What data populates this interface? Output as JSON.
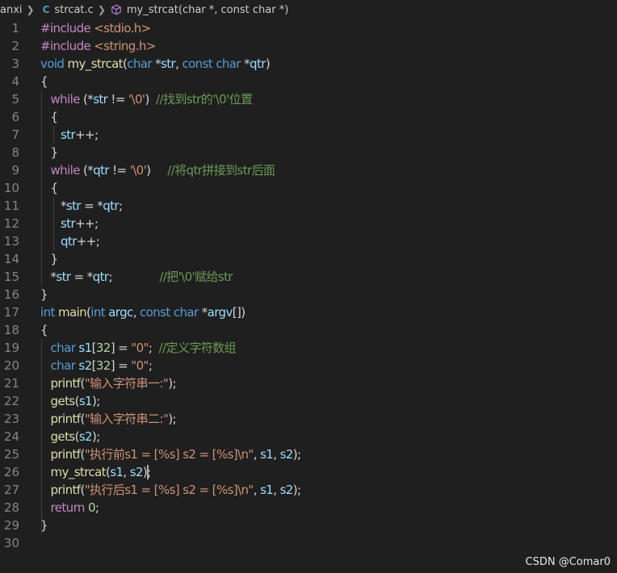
{
  "breadcrumb": {
    "folder": "anxi",
    "file": "strcat.c",
    "file_icon": "C",
    "symbol": "my_strcat(char *, const char *)"
  },
  "watermark": "CSDN @Comar0",
  "code_lines": [
    [
      [
        "pp",
        "#include "
      ],
      [
        "inc",
        "<stdio.h>"
      ]
    ],
    [
      [
        "pp",
        "#include "
      ],
      [
        "inc",
        "<string.h>"
      ]
    ],
    [
      [
        "kw",
        "void "
      ],
      [
        "fn",
        "my_strcat"
      ],
      [
        "pl",
        "("
      ],
      [
        "kw",
        "char "
      ],
      [
        "pl",
        "*"
      ],
      [
        "var",
        "str"
      ],
      [
        "pl",
        ", "
      ],
      [
        "kw",
        "const char "
      ],
      [
        "pl",
        "*"
      ],
      [
        "var",
        "qtr"
      ],
      [
        "pl",
        ")"
      ]
    ],
    [
      [
        "br",
        "{"
      ]
    ],
    [
      [
        "pl",
        "   "
      ],
      [
        "ctl",
        "while "
      ],
      [
        "pl",
        "(*"
      ],
      [
        "var",
        "str"
      ],
      [
        "pl",
        " != "
      ],
      [
        "str",
        "'\\0'"
      ],
      [
        "pl",
        ")  "
      ],
      [
        "cmt",
        "//找到str的'\\0'位置"
      ]
    ],
    [
      [
        "pl",
        "   "
      ],
      [
        "br",
        "{"
      ]
    ],
    [
      [
        "pl",
        "      "
      ],
      [
        "var",
        "str"
      ],
      [
        "pl",
        "++;"
      ]
    ],
    [
      [
        "pl",
        "   "
      ],
      [
        "br",
        "}"
      ]
    ],
    [
      [
        "pl",
        "   "
      ],
      [
        "ctl",
        "while "
      ],
      [
        "pl",
        "(*"
      ],
      [
        "var",
        "qtr"
      ],
      [
        "pl",
        " != "
      ],
      [
        "str",
        "'\\0'"
      ],
      [
        "pl",
        ")     "
      ],
      [
        "cmt",
        "//将qtr拼接到str后面"
      ]
    ],
    [
      [
        "pl",
        "   "
      ],
      [
        "br",
        "{"
      ]
    ],
    [
      [
        "pl",
        "      "
      ],
      [
        "pl",
        "*"
      ],
      [
        "var",
        "str"
      ],
      [
        "pl",
        " = *"
      ],
      [
        "var",
        "qtr"
      ],
      [
        "pl",
        ";"
      ]
    ],
    [
      [
        "pl",
        "      "
      ],
      [
        "var",
        "str"
      ],
      [
        "pl",
        "++;"
      ]
    ],
    [
      [
        "pl",
        "      "
      ],
      [
        "var",
        "qtr"
      ],
      [
        "pl",
        "++;"
      ]
    ],
    [
      [
        "pl",
        "   "
      ],
      [
        "br",
        "}"
      ]
    ],
    [
      [
        "pl",
        "   "
      ],
      [
        "pl",
        "*"
      ],
      [
        "var",
        "str"
      ],
      [
        "pl",
        " = *"
      ],
      [
        "var",
        "qtr"
      ],
      [
        "pl",
        ";              "
      ],
      [
        "cmt",
        "//把'\\0'赋给str"
      ]
    ],
    [
      [
        "br",
        "}"
      ]
    ],
    [
      [
        "kw",
        "int "
      ],
      [
        "fn",
        "main"
      ],
      [
        "pl",
        "("
      ],
      [
        "kw",
        "int "
      ],
      [
        "var",
        "argc"
      ],
      [
        "pl",
        ", "
      ],
      [
        "kw",
        "const char "
      ],
      [
        "pl",
        "*"
      ],
      [
        "var",
        "argv"
      ],
      [
        "pl",
        "[]"
      ],
      [
        "pl",
        ")"
      ]
    ],
    [
      [
        "br",
        "{"
      ]
    ],
    [
      [
        "pl",
        "   "
      ],
      [
        "kw",
        "char "
      ],
      [
        "var",
        "s1"
      ],
      [
        "pl",
        "["
      ],
      [
        "num",
        "32"
      ],
      [
        "pl",
        "] = "
      ],
      [
        "str",
        "\"0\""
      ],
      [
        "pl",
        ";  "
      ],
      [
        "cmt",
        "//定义字符数组"
      ]
    ],
    [
      [
        "pl",
        "   "
      ],
      [
        "kw",
        "char "
      ],
      [
        "var",
        "s2"
      ],
      [
        "pl",
        "["
      ],
      [
        "num",
        "32"
      ],
      [
        "pl",
        "] = "
      ],
      [
        "str",
        "\"0\""
      ],
      [
        "pl",
        ";"
      ]
    ],
    [
      [
        "pl",
        "   "
      ],
      [
        "fn",
        "printf"
      ],
      [
        "pl",
        "("
      ],
      [
        "str",
        "\"输入字符串一:\""
      ],
      [
        "pl",
        ");"
      ]
    ],
    [
      [
        "pl",
        "   "
      ],
      [
        "fn",
        "gets"
      ],
      [
        "pl",
        "("
      ],
      [
        "var",
        "s1"
      ],
      [
        "pl",
        ");"
      ]
    ],
    [
      [
        "pl",
        "   "
      ],
      [
        "fn",
        "printf"
      ],
      [
        "pl",
        "("
      ],
      [
        "str",
        "\"输入字符串二:\""
      ],
      [
        "pl",
        ");"
      ]
    ],
    [
      [
        "pl",
        "   "
      ],
      [
        "fn",
        "gets"
      ],
      [
        "pl",
        "("
      ],
      [
        "var",
        "s2"
      ],
      [
        "pl",
        ");"
      ]
    ],
    [
      [
        "pl",
        "   "
      ],
      [
        "fn",
        "printf"
      ],
      [
        "pl",
        "("
      ],
      [
        "str",
        "\"执行前s1 = [%s] s2 = [%s]\\n\""
      ],
      [
        "pl",
        ", "
      ],
      [
        "var",
        "s1"
      ],
      [
        "pl",
        ", "
      ],
      [
        "var",
        "s2"
      ],
      [
        "pl",
        ");"
      ]
    ],
    [
      [
        "pl",
        "   "
      ],
      [
        "fn",
        "my_strcat"
      ],
      [
        "pl",
        "("
      ],
      [
        "var",
        "s1"
      ],
      [
        "pl",
        ", "
      ],
      [
        "var",
        "s2"
      ],
      [
        "pl",
        ");"
      ]
    ],
    [
      [
        "pl",
        "   "
      ],
      [
        "fn",
        "printf"
      ],
      [
        "pl",
        "("
      ],
      [
        "str",
        "\"执行后s1 = [%s] s2 = [%s]\\n\""
      ],
      [
        "pl",
        ", "
      ],
      [
        "var",
        "s1"
      ],
      [
        "pl",
        ", "
      ],
      [
        "var",
        "s2"
      ],
      [
        "pl",
        ");"
      ]
    ],
    [
      [
        "pl",
        "   "
      ],
      [
        "ctl",
        "return "
      ],
      [
        "num",
        "0"
      ],
      [
        "pl",
        ";"
      ]
    ],
    [
      [
        "br",
        "}"
      ]
    ],
    [
      [
        "pl",
        ""
      ]
    ]
  ],
  "line_numbers": [
    "1",
    "2",
    "3",
    "4",
    "5",
    "6",
    "7",
    "8",
    "9",
    "10",
    "11",
    "12",
    "13",
    "14",
    "15",
    "16",
    "17",
    "18",
    "19",
    "20",
    "21",
    "22",
    "23",
    "24",
    "25",
    "26",
    "27",
    "28",
    "29",
    "30"
  ],
  "colors": {
    "background": "#1f1f1f",
    "keyword": "#569cd6",
    "control": "#c586c0",
    "function": "#dcdcaa",
    "variable": "#9cdcfe",
    "string": "#ce9178",
    "number": "#b5cea8",
    "comment": "#6a9955"
  }
}
